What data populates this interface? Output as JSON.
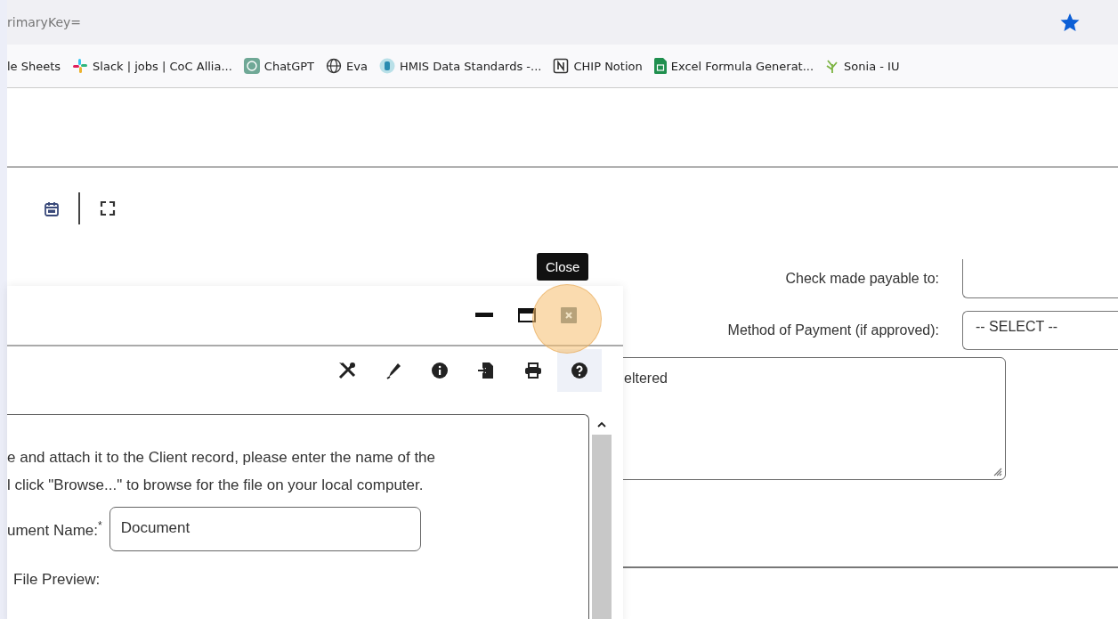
{
  "browser": {
    "address": "rimaryKey=",
    "bookmarked": true,
    "bookmarks": [
      {
        "label": "le Sheets",
        "kind": "none"
      },
      {
        "label": "Slack | jobs | CoC Allia...",
        "kind": "slack"
      },
      {
        "label": "ChatGPT",
        "kind": "chatgpt"
      },
      {
        "label": "Eva",
        "kind": "globe"
      },
      {
        "label": "HMIS Data Standards -...",
        "kind": "hmis"
      },
      {
        "label": "CHIP Notion",
        "kind": "notion"
      },
      {
        "label": "Excel Formula Generat...",
        "kind": "sheet"
      },
      {
        "label": "Sonia - IU",
        "kind": "leaf"
      }
    ]
  },
  "form": {
    "fields": [
      {
        "label": "Check made payable to:",
        "kind": "text"
      },
      {
        "label": "Method of Payment (if approved):",
        "kind": "select",
        "value": "-- SELECT --"
      }
    ],
    "notes": {
      "value": "eltered"
    }
  },
  "dialog": {
    "tooltip": "Close",
    "instructions": [
      "e and attach it to the Client record, please enter the name of the",
      "l click \"Browse...\" to browse for the file on your local computer."
    ],
    "document_name": {
      "label": "ument Name:",
      "required_mark": "*",
      "value": "Document"
    },
    "file_preview_label": "File Preview:"
  }
}
